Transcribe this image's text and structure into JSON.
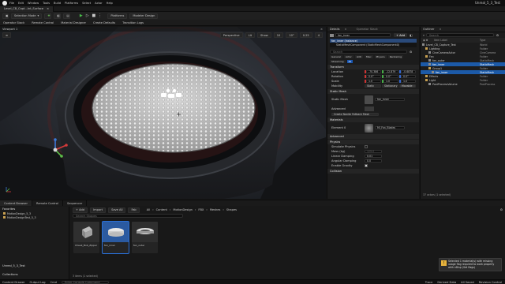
{
  "app": {
    "project_title": "Unreal_5_3_Test"
  },
  "menu": [
    "File",
    "Edit",
    "Window",
    "Tools",
    "Build",
    "Platforms",
    "Select",
    "Actor",
    "Help"
  ],
  "tabs": [
    {
      "label": "Level_CB_Capt...Int_Surface"
    }
  ],
  "toolbar": {
    "mode_label": "Selection Mode",
    "platform_label": "Platforms",
    "mode": "Modeler Design"
  },
  "subbar": {
    "items": [
      "Operator Stack",
      "Remote Control",
      "Material Designer",
      "Create Defaults",
      "Transition Logs"
    ]
  },
  "viewport": {
    "tab": "Viewport 1",
    "perspective": "Perspective",
    "lit": "Lit",
    "show": "Show",
    "snap_values": [
      "10",
      "10°",
      "0.25",
      "4"
    ]
  },
  "details": {
    "tab": "Details",
    "tab2": "Operator Stack",
    "actor": "fan_inner",
    "add": "+ Add",
    "components": [
      "fan_inner (Instance)",
      "StaticMeshComponent (StaticMeshComponent0)"
    ],
    "search": "Search",
    "filters": [
      "General",
      "Actor",
      "LOD",
      "Misc",
      "Physics",
      "Rendering",
      "Streaming",
      "All"
    ],
    "transform": {
      "title": "Transform",
      "location": "Location",
      "rotation": "Rotation",
      "scale": "Scale",
      "mobility": "Mobility",
      "loc": [
        "-70.386",
        "-12.879",
        "-0.6878"
      ],
      "rot": [
        "0.0°",
        "0.0°",
        "0.0°"
      ],
      "scl": [
        "1.0",
        "1.0",
        "1.0"
      ],
      "mob": [
        "Static",
        "Stationary",
        "Movable"
      ]
    },
    "static_mesh": {
      "title": "Static Mesh",
      "label": "Static Mesh",
      "value": "fan_inner"
    },
    "advanced": "Advanced",
    "fallback": "Create Nanite Fallback Mesh",
    "materials": {
      "title": "Materials",
      "label": "Element 0",
      "value": "MI_Fan_Blades"
    },
    "physics": {
      "title": "Physics",
      "rows": [
        [
          "Simulate Physics",
          ""
        ],
        [
          "Mass (kg)",
          "129.0"
        ],
        [
          "Linear Damping",
          "0.01"
        ],
        [
          "Angular Damping",
          "0.0"
        ],
        [
          "Enable Gravity",
          ""
        ]
      ]
    },
    "collision": "Collision"
  },
  "outliner": {
    "tab": "Outliner",
    "search": "Search",
    "col1": "Item Label",
    "col2": "Type",
    "rows": [
      {
        "label": "Level_CB_Capture_Test",
        "type": "World",
        "sel": false
      },
      {
        "label": "Lighting",
        "type": "Folder",
        "sel": false
      },
      {
        "label": "CineCameraActor",
        "type": "CineCamera",
        "sel": false
      },
      {
        "label": "Fan",
        "type": "Folder",
        "sel": false
      },
      {
        "label": "fan_outer",
        "type": "StaticMesh",
        "sel": false
      },
      {
        "label": "fan_inner",
        "type": "StaticMesh",
        "sel": true
      },
      {
        "label": "Group1",
        "type": "Folder",
        "sel": false
      },
      {
        "label": "fan_inner",
        "type": "StaticMesh",
        "sel": true
      },
      {
        "label": "Effects",
        "type": "Folder",
        "sel": false
      },
      {
        "label": "Light",
        "type": "Folder",
        "sel": false
      },
      {
        "label": "PostProcessVolume",
        "type": "PostProcess",
        "sel": false
      }
    ],
    "count": "37 actors (1 selected)"
  },
  "content_browser": {
    "tabs": [
      "Content Browser",
      "Remote Control",
      "Sequencer"
    ],
    "add": "+ Add",
    "import": "Import",
    "save_all": "Save All",
    "fab": "Fab",
    "breadcrumb": [
      "All",
      "Content",
      "MotionDesign",
      "FBX",
      "Meshes",
      "Shapes"
    ],
    "search": "Search Shapes",
    "favorites_label": "Favorites",
    "fav_items": [
      "MotionDesign_5_3",
      "MotionDesignTest_5_3"
    ],
    "project_label": "Unreal_5_3_Test",
    "collections": "Collections",
    "assets": [
      {
        "name": "Cheek_Bob_Zipper",
        "sel": false
      },
      {
        "name": "fan_inner",
        "sel": true
      },
      {
        "name": "fan_outer",
        "sel": false
      }
    ],
    "count": "3 items (1 selected)"
  },
  "toast": {
    "text": "Selected 1 material(s) with missing usage flag required to work properly with nDisp (Set flags)"
  },
  "status": {
    "items": [
      "Content Drawer",
      "Output Log",
      "Cmd",
      "Enter Console Command"
    ],
    "right": [
      "Trace",
      "Derived Data",
      "All Saved",
      "Revision Control"
    ]
  },
  "colors": {
    "accent": "#1a56b0",
    "selected": "#2a6fd6",
    "warning": "#e6b23c"
  }
}
